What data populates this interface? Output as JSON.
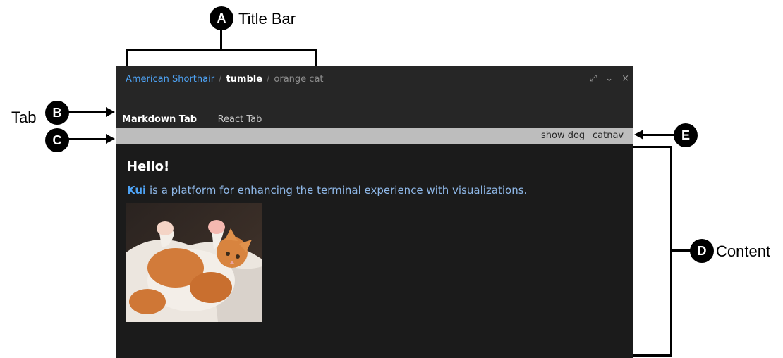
{
  "annotations": {
    "a": {
      "marker": "A",
      "label": "Title Bar"
    },
    "b": {
      "marker": "B",
      "label": "Tab"
    },
    "c": {
      "marker": "C"
    },
    "d": {
      "marker": "D",
      "label": "Content"
    },
    "e": {
      "marker": "E"
    }
  },
  "window": {
    "breadcrumb": {
      "app": "American Shorthair",
      "separator": "/",
      "command": "tumble",
      "sub": "orange cat"
    },
    "controls": {
      "maximize": "⤢",
      "collapse": "⌄",
      "close": "×"
    },
    "tabs": [
      {
        "label": "Markdown Tab",
        "active": true
      },
      {
        "label": "React Tab",
        "active": false
      }
    ],
    "toolbar": {
      "show_dog": "show dog",
      "catnav": "catnav"
    },
    "content": {
      "heading": "Hello!",
      "link_text": "Kui",
      "paragraph_rest": " is a platform for enhancing the terminal experience with visualizations."
    }
  },
  "colors": {
    "accent": "#4ea3f5",
    "window_bg": "#1b1b1b",
    "chrome_bg": "#262626",
    "toolbar_bg": "#bdbdbd"
  }
}
